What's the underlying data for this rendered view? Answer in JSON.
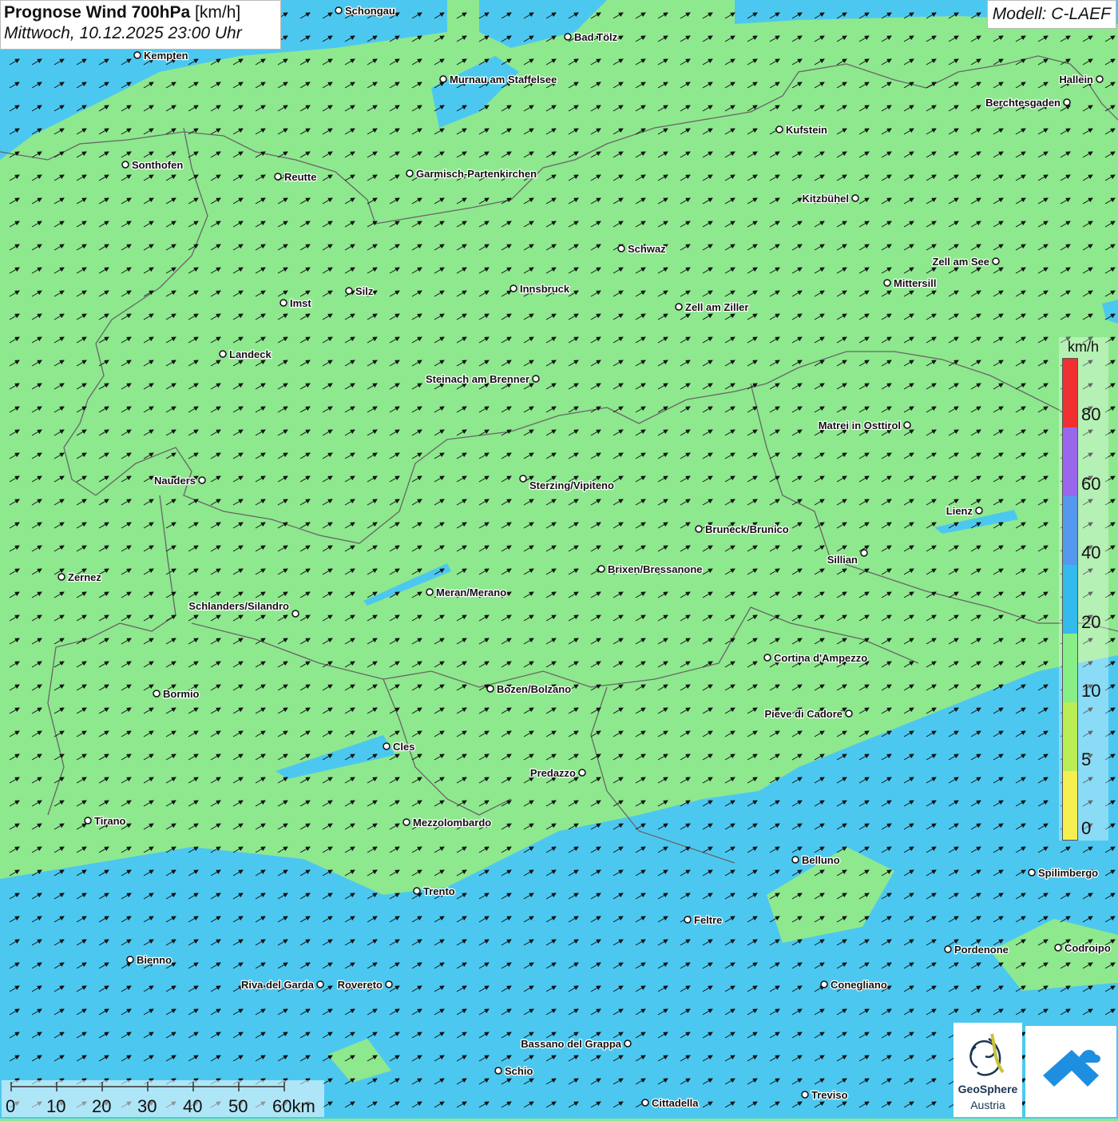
{
  "title": {
    "main": "Prognose Wind 700hPa",
    "unit": "[km/h]",
    "datetime": "Mittwoch, 10.12.2025 23:00 Uhr"
  },
  "model": "Modell: C-LAEF",
  "legend": {
    "unit": "km/h",
    "ticks": [
      "80",
      "60",
      "40",
      "20",
      "10",
      "5",
      "0"
    ],
    "colors": [
      "#f03030",
      "#9966ee",
      "#5599ee",
      "#33bbee",
      "#88ee88",
      "#bbee55",
      "#f5f050"
    ]
  },
  "scale_bar": {
    "labels": [
      "0",
      "10",
      "20",
      "30",
      "40",
      "50",
      "60km"
    ]
  },
  "logos": {
    "geosphere_name": "GeoSphere",
    "geosphere_country": "Austria"
  },
  "map": {
    "colors": {
      "calm_green": "#8ee88e",
      "blue_band": "#4cc8f0",
      "light_blue": "#55c8f5"
    },
    "wind_direction": "southwest",
    "cities": [
      {
        "name": "Schongau"
      },
      {
        "name": "Bad Tölz"
      },
      {
        "name": "Kempten"
      },
      {
        "name": "Murnau am Staffelsee"
      },
      {
        "name": "Hallein"
      },
      {
        "name": "Berchtesgaden"
      },
      {
        "name": "Kufstein"
      },
      {
        "name": "Sonthofen"
      },
      {
        "name": "Reutte"
      },
      {
        "name": "Garmisch-Partenkirchen"
      },
      {
        "name": "Kitzbühel"
      },
      {
        "name": "Schwaz"
      },
      {
        "name": "Zell am See"
      },
      {
        "name": "Mittersill"
      },
      {
        "name": "Innsbruck"
      },
      {
        "name": "Silz"
      },
      {
        "name": "Imst"
      },
      {
        "name": "Zell am Ziller"
      },
      {
        "name": "Landeck"
      },
      {
        "name": "Steinach am Brenner"
      },
      {
        "name": "Matrei in Osttirol"
      },
      {
        "name": "Nauders"
      },
      {
        "name": "Sterzing/Vipiteno"
      },
      {
        "name": "Lienz"
      },
      {
        "name": "Bruneck/Brunico"
      },
      {
        "name": "Sillian"
      },
      {
        "name": "Brixen/Bressanone"
      },
      {
        "name": "Zernez"
      },
      {
        "name": "Meran/Merano"
      },
      {
        "name": "Schlanders/Silandro"
      },
      {
        "name": "Cortina d'Ampezzo"
      },
      {
        "name": "Bozen/Bolzano"
      },
      {
        "name": "Bormio"
      },
      {
        "name": "Pieve di Cadore"
      },
      {
        "name": "Cles"
      },
      {
        "name": "Predazzo"
      },
      {
        "name": "Tirano"
      },
      {
        "name": "Mezzolombardo"
      },
      {
        "name": "Belluno"
      },
      {
        "name": "Spilimbergo"
      },
      {
        "name": "Trento"
      },
      {
        "name": "Feltre"
      },
      {
        "name": "Bienno"
      },
      {
        "name": "Pordenone"
      },
      {
        "name": "Codroipo"
      },
      {
        "name": "Riva del Garda"
      },
      {
        "name": "Rovereto"
      },
      {
        "name": "Conegliano"
      },
      {
        "name": "Bassano del Grappa"
      },
      {
        "name": "Schio"
      },
      {
        "name": "Treviso"
      },
      {
        "name": "Cittadella"
      }
    ]
  }
}
